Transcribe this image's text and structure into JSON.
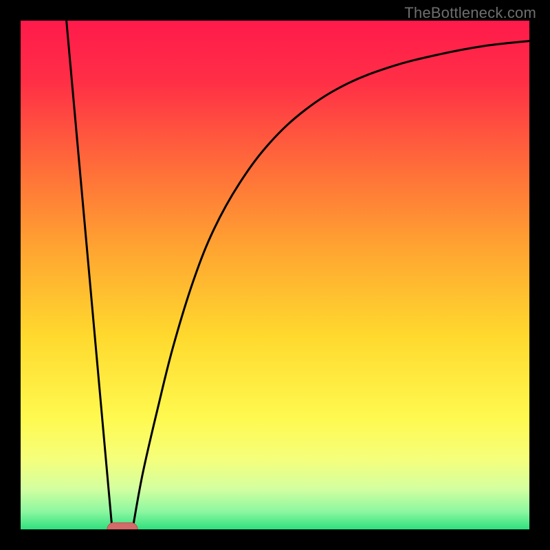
{
  "watermark": "TheBottleneck.com",
  "colors": {
    "black": "#000000",
    "curve": "#000000",
    "marker_fill": "#d46a6a",
    "marker_stroke": "#c05050"
  },
  "chart_data": {
    "type": "line",
    "title": "",
    "xlabel": "",
    "ylabel": "",
    "xlim": [
      0,
      100
    ],
    "ylim": [
      0,
      100
    ],
    "grid": false,
    "legend": false,
    "gradient_stops": [
      {
        "pos": 0.0,
        "color": "#ff1a4b"
      },
      {
        "pos": 0.12,
        "color": "#ff2f46"
      },
      {
        "pos": 0.28,
        "color": "#ff6a3a"
      },
      {
        "pos": 0.45,
        "color": "#ffa531"
      },
      {
        "pos": 0.62,
        "color": "#ffd92e"
      },
      {
        "pos": 0.78,
        "color": "#fff94f"
      },
      {
        "pos": 0.86,
        "color": "#f6ff7a"
      },
      {
        "pos": 0.92,
        "color": "#d4ffa0"
      },
      {
        "pos": 0.965,
        "color": "#8cf7a0"
      },
      {
        "pos": 1.0,
        "color": "#2fe07e"
      }
    ],
    "series": [
      {
        "name": "left-line",
        "type": "line",
        "points": [
          {
            "x": 9.0,
            "y": 100.0
          },
          {
            "x": 18.0,
            "y": 0.0
          }
        ]
      },
      {
        "name": "right-curve",
        "type": "line",
        "points": [
          {
            "x": 22.0,
            "y": 0.0
          },
          {
            "x": 24.0,
            "y": 11.0
          },
          {
            "x": 27.0,
            "y": 24.0
          },
          {
            "x": 30.0,
            "y": 36.0
          },
          {
            "x": 34.0,
            "y": 49.0
          },
          {
            "x": 38.0,
            "y": 59.0
          },
          {
            "x": 43.0,
            "y": 68.0
          },
          {
            "x": 49.0,
            "y": 76.0
          },
          {
            "x": 56.0,
            "y": 82.5
          },
          {
            "x": 64.0,
            "y": 87.5
          },
          {
            "x": 73.0,
            "y": 91.0
          },
          {
            "x": 82.0,
            "y": 93.3
          },
          {
            "x": 91.0,
            "y": 95.0
          },
          {
            "x": 100.0,
            "y": 96.0
          }
        ]
      }
    ],
    "marker": {
      "x_center": 20.0,
      "y": 0.0,
      "half_width_x": 3.0,
      "radius_y": 1.3
    }
  }
}
